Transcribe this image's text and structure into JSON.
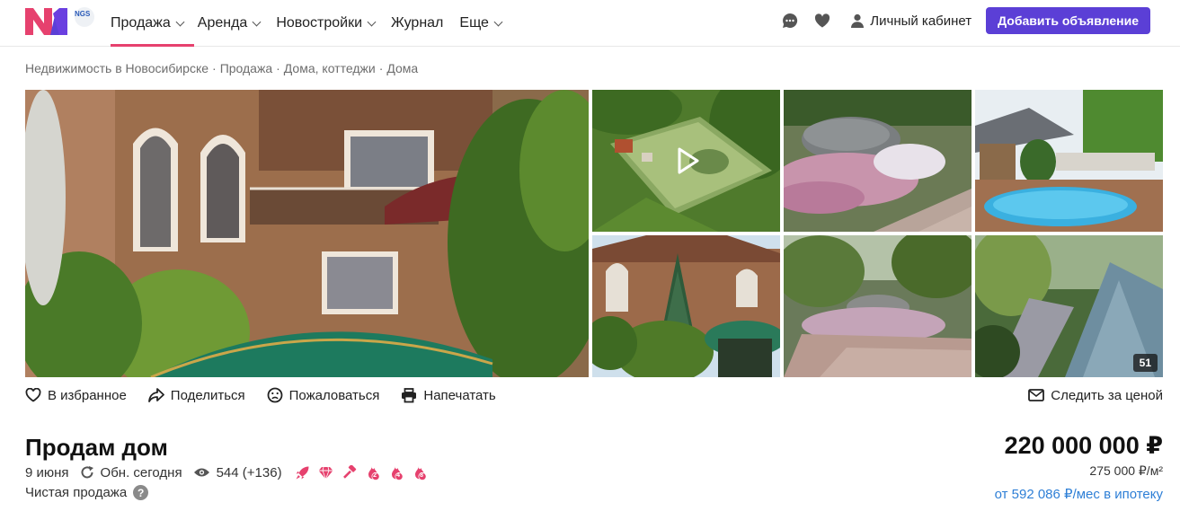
{
  "header": {
    "logo_text": "N1",
    "logo_badge": "NGS",
    "nav": [
      {
        "label": "Продажа",
        "has_dropdown": true,
        "active": true
      },
      {
        "label": "Аренда",
        "has_dropdown": true,
        "active": false
      },
      {
        "label": "Новостройки",
        "has_dropdown": true,
        "active": false
      },
      {
        "label": "Журнал",
        "has_dropdown": false,
        "active": false
      },
      {
        "label": "Еще",
        "has_dropdown": true,
        "active": false
      }
    ],
    "chat_icon": "chat-bubble-icon",
    "favorites_icon": "heart-icon",
    "cabinet_label": "Личный кабинет",
    "add_button_label": "Добавить объявление",
    "accent_color": "#5b3fd6",
    "brand_color": "#e6416e"
  },
  "breadcrumb": [
    "Недвижимость в Новосибирске",
    "Продажа",
    "Дома, коттеджи",
    "Дома"
  ],
  "gallery": {
    "photo_count": "51",
    "has_video": true
  },
  "actions": {
    "favorite": "В избранное",
    "share": "Поделиться",
    "complain": "Пожаловаться",
    "print": "Напечатать",
    "follow_price": "Следить за ценой"
  },
  "listing": {
    "title": "Продам дом",
    "date": "9 июня",
    "updated": "Обн. сегодня",
    "views": "544 (+136)",
    "promo_badges": [
      "rocket-icon",
      "diamond-icon",
      "hammer-icon",
      "fire-2-icon",
      "fire-4-icon",
      "fire-8-icon"
    ],
    "badge_color": "#e6416e",
    "badge_numbers": [
      "2",
      "4",
      "8"
    ],
    "sale_type": "Чистая продажа",
    "price": "220 000 000 ₽",
    "price_per_m2": "275 000 ₽/м²",
    "mortgage": "от 592 086 ₽/мес в ипотеку",
    "link_color": "#2e7fd6"
  }
}
